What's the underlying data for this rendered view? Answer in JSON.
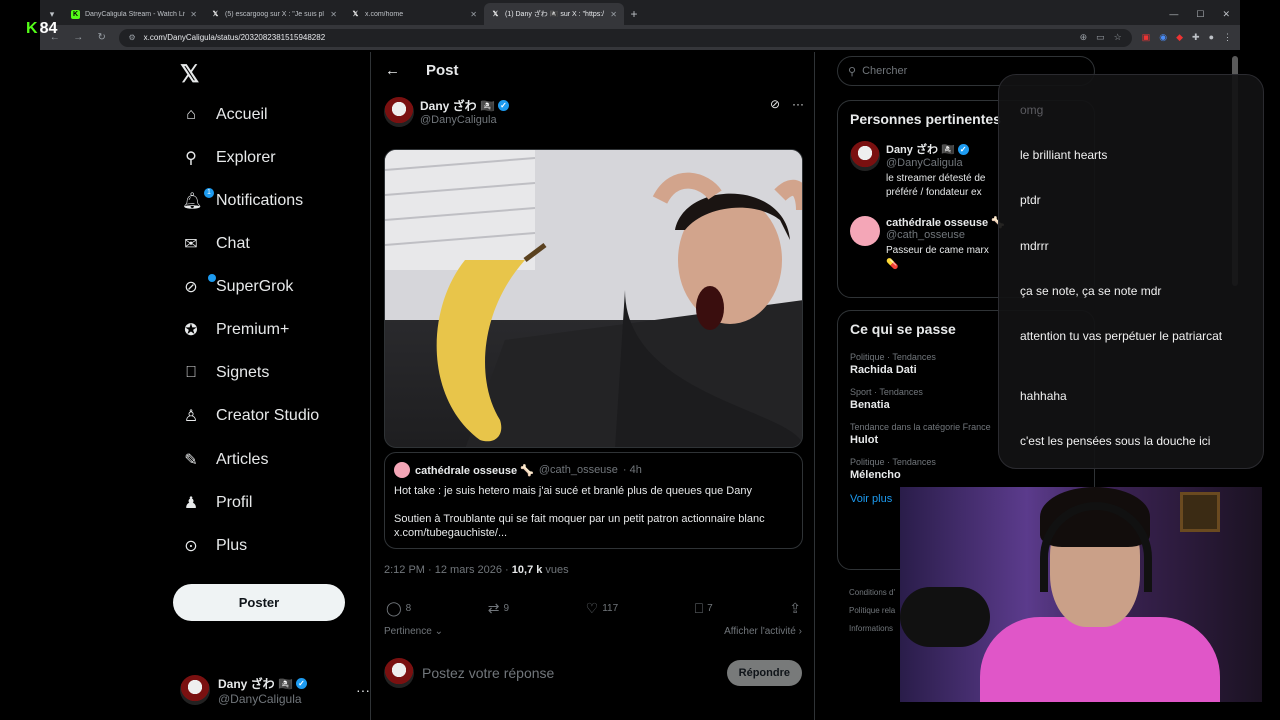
{
  "browser": {
    "tabs": [
      {
        "title": "DanyCaligula Stream - Watch Liv",
        "icon": "kick-icon",
        "active": false
      },
      {
        "title": "(5) escargoog sur X : \"Je suis pl",
        "icon": "x-icon",
        "active": false
      },
      {
        "title": "x.com/home",
        "icon": "x-icon",
        "active": false
      },
      {
        "title": "(1) Dany ざわ 🏴‍☠️ sur X : \"https:/",
        "icon": "x-icon",
        "active": true
      }
    ],
    "url": "x.com/DanyCaligula/status/2032082381515948282"
  },
  "stream_logo": {
    "k": "K",
    "num": "84"
  },
  "nav": {
    "items": [
      {
        "label": "Accueil",
        "icon": "home-icon",
        "glyph": "⌂"
      },
      {
        "label": "Explorer",
        "icon": "search-icon",
        "glyph": "⚲"
      },
      {
        "label": "Notifications",
        "icon": "bell-icon",
        "glyph": "🔔︎"
      },
      {
        "label": "Chat",
        "icon": "mail-icon",
        "glyph": "✉"
      },
      {
        "label": "SuperGrok",
        "icon": "grok-icon",
        "glyph": "⊘"
      },
      {
        "label": "Premium+",
        "icon": "verified-icon",
        "glyph": "✪"
      },
      {
        "label": "Signets",
        "icon": "bookmark-icon",
        "glyph": "⎕"
      },
      {
        "label": "Creator Studio",
        "icon": "creator-icon",
        "glyph": "♙"
      },
      {
        "label": "Articles",
        "icon": "article-icon",
        "glyph": "✎"
      },
      {
        "label": "Profil",
        "icon": "profile-icon",
        "glyph": "♟"
      },
      {
        "label": "Plus",
        "icon": "more-circle-icon",
        "glyph": "⊙"
      }
    ],
    "notif_badge": "1",
    "post_button": "Poster",
    "user": {
      "name": "Dany ざわ 🏴‍☠️",
      "handle": "@DanyCaligula"
    }
  },
  "main": {
    "header": "Post",
    "author": {
      "name": "Dany ざわ 🏴‍☠️",
      "handle": "@DanyCaligula"
    },
    "quote": {
      "name": "cathédrale osseuse 🦴",
      "handle": "@cath_osseuse",
      "time": "· 4h",
      "text": "Hot take : je suis hetero mais j'ai sucé et branlé plus de queues que Dany\n\nSoutien à Troublante qui se fait moquer par un petit patron actionnaire blanc\nx.com/tubegauchiste/..."
    },
    "meta": {
      "datetime": "2:12 PM · 12 mars 2026 · ",
      "views_count": "10,7 k",
      "views_label": " vues"
    },
    "actions": {
      "replies": "8",
      "reposts": "9",
      "likes": "117",
      "bookmarks": "7"
    },
    "sort_label": "Pertinence",
    "activity_label": "Afficher l'activité",
    "reply_placeholder": "Postez votre réponse",
    "reply_button": "Répondre"
  },
  "right": {
    "search_placeholder": "Chercher",
    "relevant": {
      "title": "Personnes pertinentes",
      "people": [
        {
          "name": "Dany ざわ 🏴‍☠️",
          "handle": "@DanyCaligula",
          "bio": "le streamer détesté de\npréféré / fondateur ex"
        },
        {
          "name": "cathédrale osseuse 🦴",
          "handle": "@cath_osseuse",
          "bio": "Passeur de came marx\n💊"
        }
      ]
    },
    "trends": {
      "title": "Ce qui se passe",
      "items": [
        {
          "category": "Politique · Tendances",
          "name": "Rachida Dati"
        },
        {
          "category": "Sport · Tendances",
          "name": "Benatia"
        },
        {
          "category": "Tendance dans la catégorie France",
          "name": "Hulot"
        },
        {
          "category": "Politique · Tendances",
          "name": "Mélencho"
        }
      ],
      "see_more": "Voir plus"
    },
    "footer": [
      "Conditions d'",
      "Politique rela",
      "Informations"
    ]
  },
  "chat": {
    "messages": [
      {
        "text": "omg",
        "faded": true
      },
      {
        "text": "le brilliant hearts",
        "faded": false
      },
      {
        "text": "ptdr",
        "faded": false
      },
      {
        "text": "mdrrr",
        "faded": false
      },
      {
        "text": "ça se note, ça se note mdr",
        "faded": false
      },
      {
        "text": "attention tu vas perpétuer le patriarcat",
        "faded": false
      },
      {
        "text": "hahhaha",
        "faded": false
      },
      {
        "text": "c'est les pensées sous la douche ici",
        "faded": false
      }
    ]
  }
}
